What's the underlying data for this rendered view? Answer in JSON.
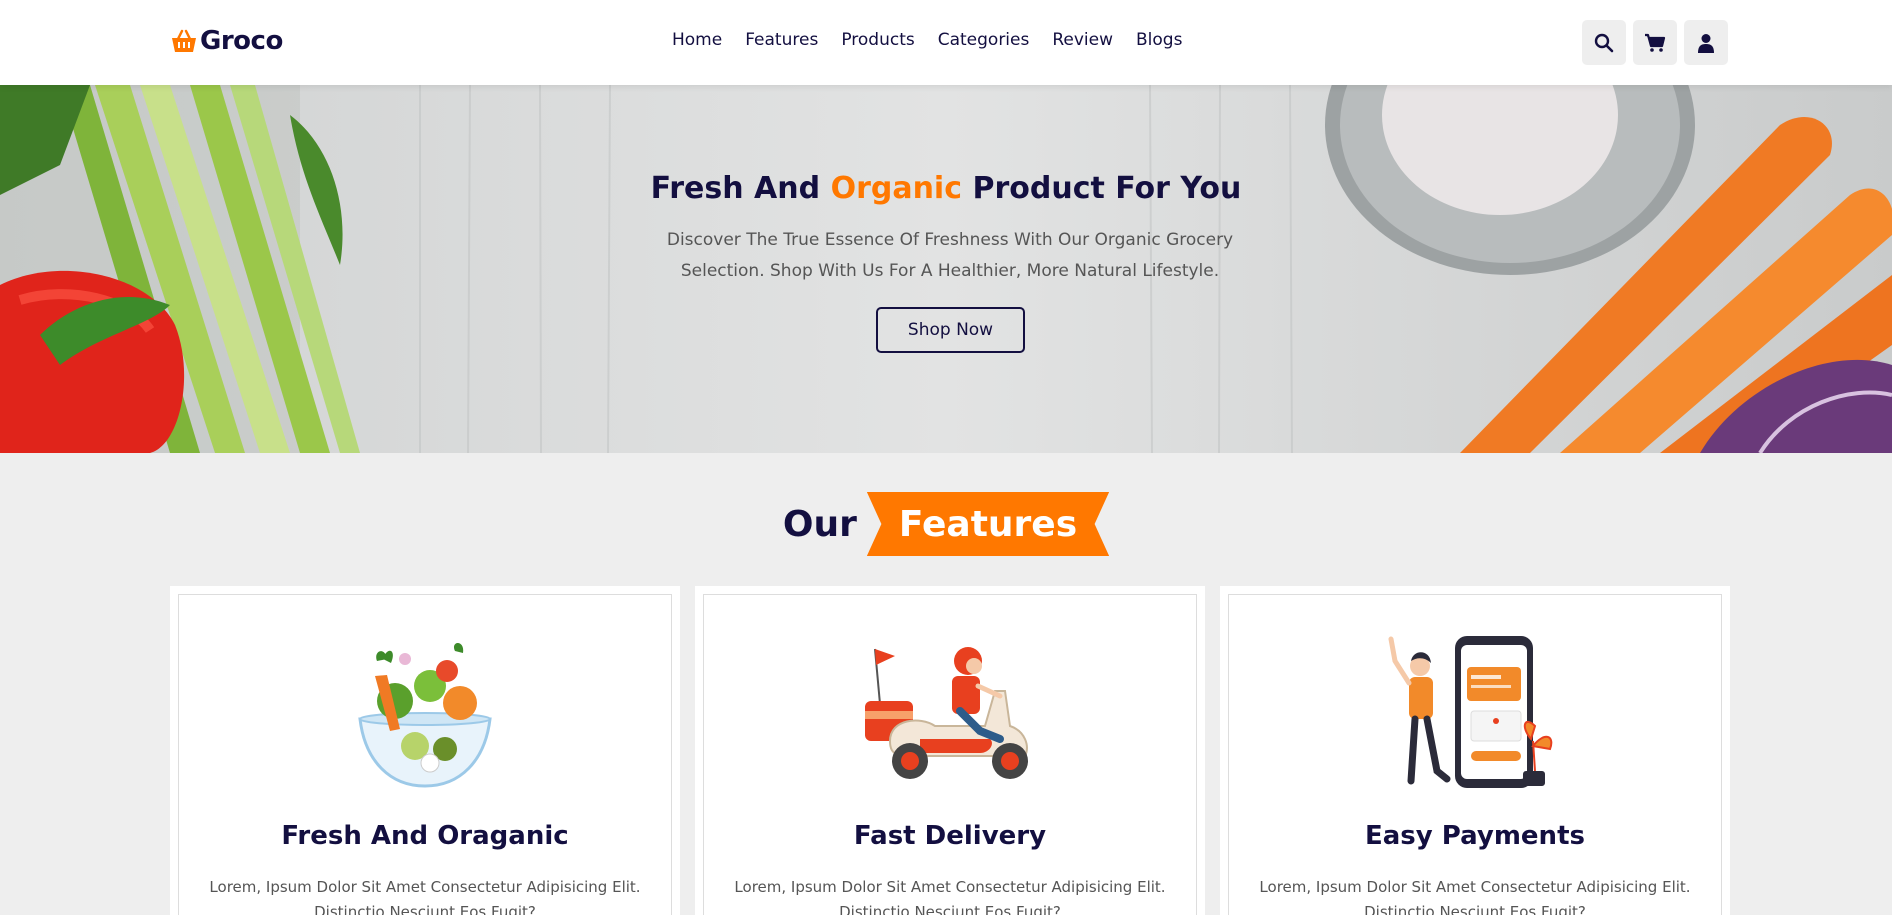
{
  "brand": {
    "name": "Groco",
    "accent": "#ff7800",
    "primary": "#130f40"
  },
  "nav": {
    "items": [
      "Home",
      "Features",
      "Products",
      "Categories",
      "Review",
      "Blogs"
    ]
  },
  "header_icons": [
    "search-icon",
    "cart-icon",
    "user-icon"
  ],
  "hero": {
    "title_part1": "Fresh And",
    "title_accent": "Organic",
    "title_part2": "Product For You",
    "description": "Discover The True Essence Of Freshness With Our Organic Grocery Selection. Shop With Us For A Healthier, More Natural Lifestyle.",
    "button": "Shop Now"
  },
  "features": {
    "heading_plain": "Our",
    "heading_highlight": "Features",
    "cards": [
      {
        "title": "Fresh And Oraganic",
        "text": "Lorem, Ipsum Dolor Sit Amet Consectetur Adipisicing Elit. Distinctio Nesciunt Eos Fugit?",
        "image": "vegetable-bowl-illustration"
      },
      {
        "title": "Fast Delivery",
        "text": "Lorem, Ipsum Dolor Sit Amet Consectetur Adipisicing Elit. Distinctio Nesciunt Eos Fugit?",
        "image": "scooter-delivery-illustration"
      },
      {
        "title": "Easy Payments",
        "text": "Lorem, Ipsum Dolor Sit Amet Consectetur Adipisicing Elit. Distinctio Nesciunt Eos Fugit?",
        "image": "mobile-payment-illustration"
      }
    ]
  }
}
